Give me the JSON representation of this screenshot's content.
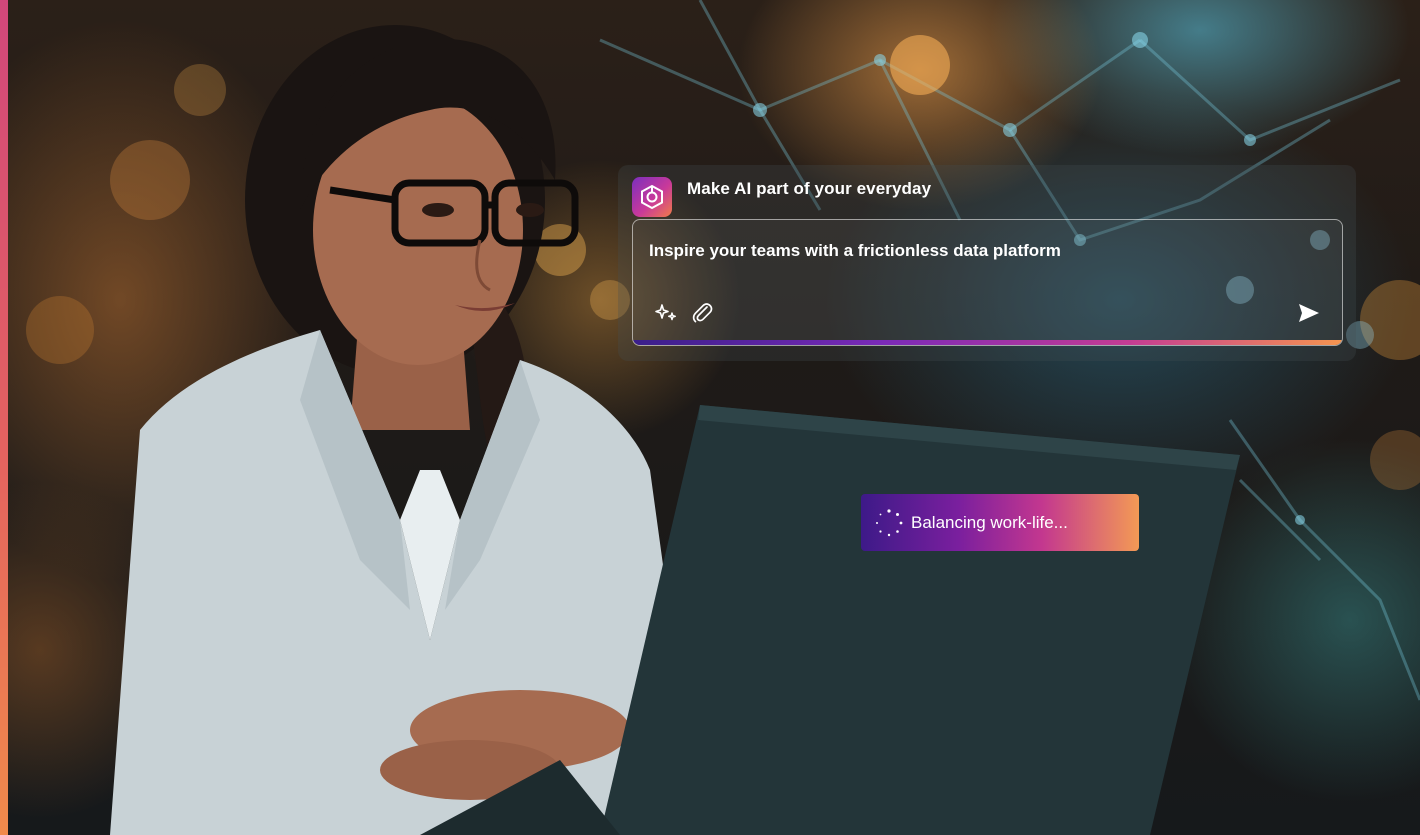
{
  "panel": {
    "title": "Make AI part of your everyday",
    "logo_icon": "copilot-logo-icon",
    "input_value": "Inspire your teams with a frictionless data platform",
    "tools": {
      "sparkle_icon": "sparkle-icon",
      "attach_icon": "paperclip-icon",
      "send_icon": "send-arrow-icon"
    }
  },
  "loading": {
    "text": "Balancing work-life...",
    "icon": "spinner-icon"
  },
  "colors": {
    "accent_start": "#3d1a88",
    "accent_mid": "#c3378f",
    "accent_end": "#f39a55",
    "stripe_top": "#d2477b",
    "stripe_bottom": "#f08a4b"
  }
}
